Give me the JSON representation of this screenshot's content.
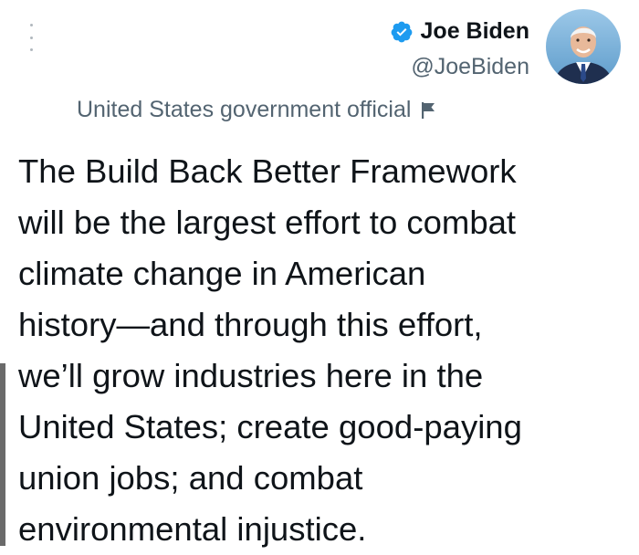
{
  "tweet": {
    "author": {
      "display_name": "Joe Biden",
      "handle": "@JoeBiden",
      "verified": true,
      "avatar_icon": "profile-photo"
    },
    "label": "United States government official",
    "label_icon": "flag-icon",
    "text": "The Build Back Better Framework\nwill be the largest effort to combat\nclimate change in American\nhistory—and through this effort,\nwe’ll grow industries here in the\nUnited States; create good-paying\nunion jobs; and combat\nenvironmental injustice.",
    "more_icon": "more-vertical-icon"
  },
  "colors": {
    "text_primary": "#0f1419",
    "text_secondary": "#536471",
    "verified_blue": "#1d9bf0",
    "avatar_background": "#7fb3d9"
  }
}
